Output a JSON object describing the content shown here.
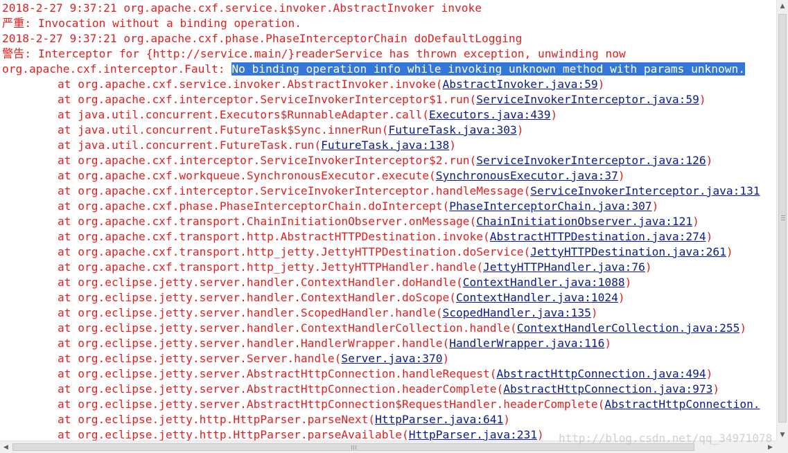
{
  "console": {
    "header_lines": [
      "2018-2-27 9:37:21 org.apache.cxf.service.invoker.AbstractInvoker invoke",
      "严重: Invocation without a binding operation.",
      "2018-2-27 9:37:21 org.apache.cxf.phase.PhaseInterceptorChain doDefaultLogging",
      "警告: Interceptor for {http://service.main/}readerService has thrown exception, unwinding now"
    ],
    "fault": {
      "prefix": "org.apache.cxf.interceptor.Fault: ",
      "message": "No binding operation info while invoking unknown method with params unknown."
    },
    "frames": [
      {
        "method": "at org.apache.cxf.service.invoker.AbstractInvoker.invoke(",
        "source": "AbstractInvoker.java:59",
        "suffix": ")"
      },
      {
        "method": "at org.apache.cxf.interceptor.ServiceInvokerInterceptor$1.run(",
        "source": "ServiceInvokerInterceptor.java:59",
        "suffix": ")"
      },
      {
        "method": "at java.util.concurrent.Executors$RunnableAdapter.call(",
        "source": "Executors.java:439",
        "suffix": ")"
      },
      {
        "method": "at java.util.concurrent.FutureTask$Sync.innerRun(",
        "source": "FutureTask.java:303",
        "suffix": ")"
      },
      {
        "method": "at java.util.concurrent.FutureTask.run(",
        "source": "FutureTask.java:138",
        "suffix": ")"
      },
      {
        "method": "at org.apache.cxf.interceptor.ServiceInvokerInterceptor$2.run(",
        "source": "ServiceInvokerInterceptor.java:126",
        "suffix": ")"
      },
      {
        "method": "at org.apache.cxf.workqueue.SynchronousExecutor.execute(",
        "source": "SynchronousExecutor.java:37",
        "suffix": ")"
      },
      {
        "method": "at org.apache.cxf.interceptor.ServiceInvokerInterceptor.handleMessage(",
        "source": "ServiceInvokerInterceptor.java:131",
        "suffix": ""
      },
      {
        "method": "at org.apache.cxf.phase.PhaseInterceptorChain.doIntercept(",
        "source": "PhaseInterceptorChain.java:307",
        "suffix": ")"
      },
      {
        "method": "at org.apache.cxf.transport.ChainInitiationObserver.onMessage(",
        "source": "ChainInitiationObserver.java:121",
        "suffix": ")"
      },
      {
        "method": "at org.apache.cxf.transport.http.AbstractHTTPDestination.invoke(",
        "source": "AbstractHTTPDestination.java:274",
        "suffix": ")"
      },
      {
        "method": "at org.apache.cxf.transport.http_jetty.JettyHTTPDestination.doService(",
        "source": "JettyHTTPDestination.java:261",
        "suffix": ")"
      },
      {
        "method": "at org.apache.cxf.transport.http_jetty.JettyHTTPHandler.handle(",
        "source": "JettyHTTPHandler.java:76",
        "suffix": ")"
      },
      {
        "method": "at org.eclipse.jetty.server.handler.ContextHandler.doHandle(",
        "source": "ContextHandler.java:1088",
        "suffix": ")"
      },
      {
        "method": "at org.eclipse.jetty.server.handler.ContextHandler.doScope(",
        "source": "ContextHandler.java:1024",
        "suffix": ")"
      },
      {
        "method": "at org.eclipse.jetty.server.handler.ScopedHandler.handle(",
        "source": "ScopedHandler.java:135",
        "suffix": ")"
      },
      {
        "method": "at org.eclipse.jetty.server.handler.ContextHandlerCollection.handle(",
        "source": "ContextHandlerCollection.java:255",
        "suffix": ")"
      },
      {
        "method": "at org.eclipse.jetty.server.handler.HandlerWrapper.handle(",
        "source": "HandlerWrapper.java:116",
        "suffix": ")"
      },
      {
        "method": "at org.eclipse.jetty.server.Server.handle(",
        "source": "Server.java:370",
        "suffix": ")"
      },
      {
        "method": "at org.eclipse.jetty.server.AbstractHttpConnection.handleRequest(",
        "source": "AbstractHttpConnection.java:494",
        "suffix": ")"
      },
      {
        "method": "at org.eclipse.jetty.server.AbstractHttpConnection.headerComplete(",
        "source": "AbstractHttpConnection.java:973",
        "suffix": ")"
      },
      {
        "method": "at org.eclipse.jetty.server.AbstractHttpConnection$RequestHandler.headerComplete(",
        "source": "AbstractHttpConnection.",
        "suffix": ""
      },
      {
        "method": "at org.eclipse.jetty.http.HttpParser.parseNext(",
        "source": "HttpParser.java:641",
        "suffix": ")"
      },
      {
        "method": "at org.eclipse.jetty.http.HttpParser.parseAvailable(",
        "source": "HttpParser.java:231",
        "suffix": ")"
      }
    ]
  },
  "watermark": "http://blog.csdn.net/qq_34971078",
  "colors": {
    "text": "#e11f1f",
    "link": "#0a1a8c",
    "selection": "#3378d9"
  },
  "icons": {
    "scroll_up": "arrow-up-icon",
    "scroll_down": "arrow-down-icon",
    "scroll_left": "arrow-left-icon",
    "scroll_right": "arrow-right-icon"
  }
}
